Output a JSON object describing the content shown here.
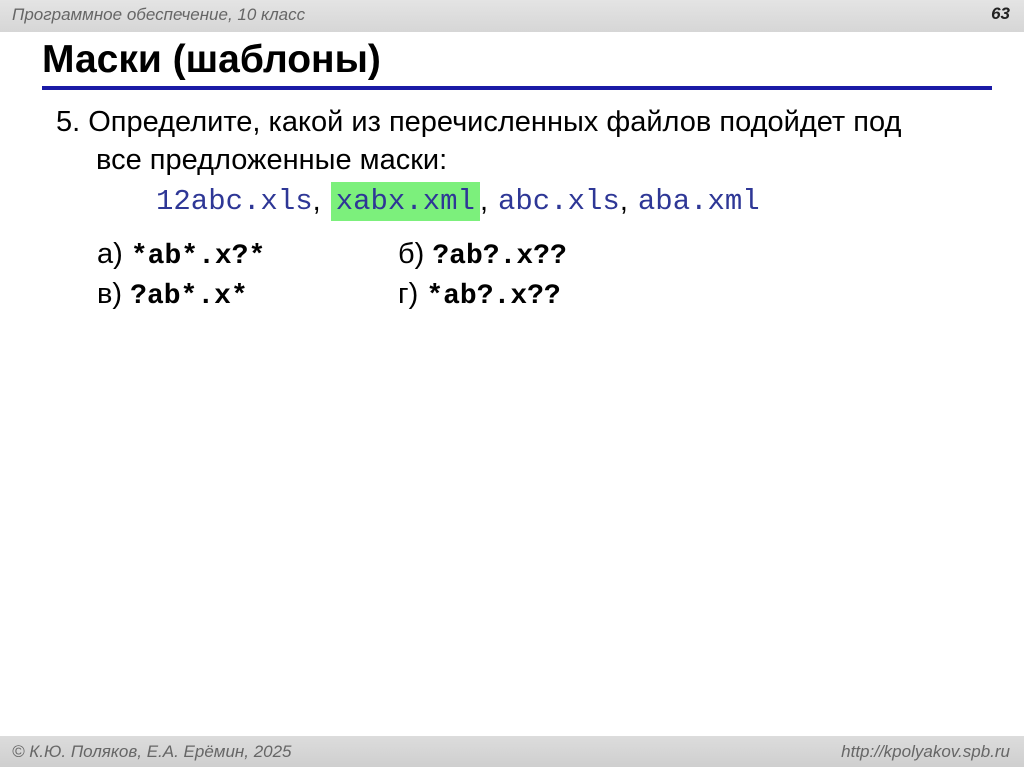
{
  "header": {
    "course": "Программное обеспечение, 10 класс",
    "slide_number": "63"
  },
  "title": "Маски (шаблоны)",
  "question": {
    "number": "5.",
    "line1": "Определите, какой из перечисленных файлов подойдет под",
    "line2": "все предложенные маски:"
  },
  "files": [
    {
      "name": "12abc.xls",
      "highlighted": false
    },
    {
      "name": "xabx.xml",
      "highlighted": true
    },
    {
      "name": "abc.xls",
      "highlighted": false
    },
    {
      "name": "aba.xml",
      "highlighted": false
    }
  ],
  "separator": ",",
  "options": [
    {
      "letter": "а)",
      "mask": "*ab*.x?*"
    },
    {
      "letter": "б)",
      "mask": "?ab?.x??"
    },
    {
      "letter": "в)",
      "mask": "?ab*.x*"
    },
    {
      "letter": "г)",
      "mask": "*ab?.x??"
    }
  ],
  "footer": {
    "author": "© К.Ю. Поляков, Е.А. Ерёмин, 2025",
    "url": "http://kpolyakov.spb.ru"
  },
  "colors": {
    "highlight": "#7cf07c",
    "file_text": "#2e3796",
    "title_rule": "#1a1aa6"
  }
}
